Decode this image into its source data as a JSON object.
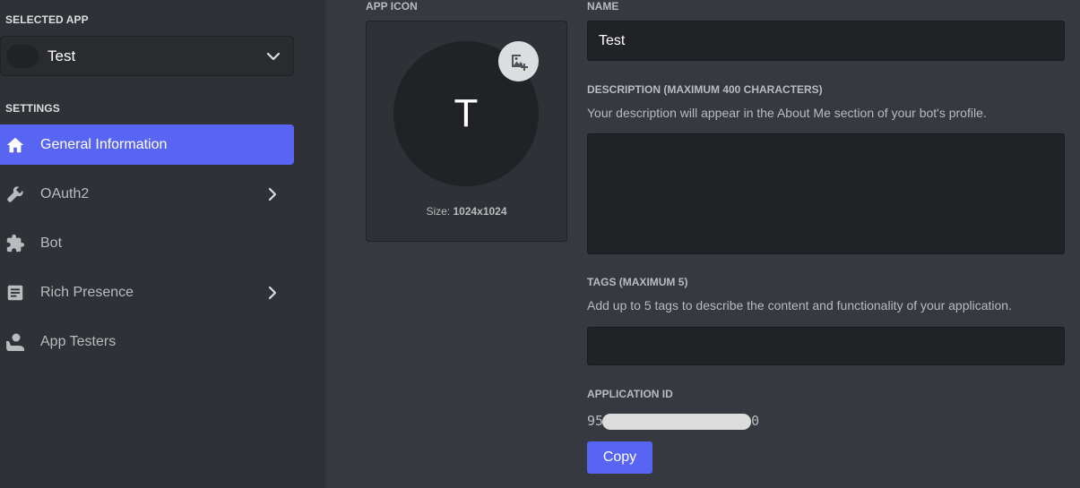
{
  "sidebar": {
    "selected_app_label": "SELECTED APP",
    "selected_app_name": "Test",
    "settings_label": "SETTINGS",
    "items": [
      {
        "label": "General Information",
        "icon": "home-icon",
        "active": true
      },
      {
        "label": "OAuth2",
        "icon": "wrench-icon"
      },
      {
        "label": "Bot",
        "icon": "puzzle-icon"
      },
      {
        "label": "Rich Presence",
        "icon": "document-icon"
      },
      {
        "label": "App Testers",
        "icon": "person-icon"
      }
    ]
  },
  "app_icon": {
    "label": "APP ICON",
    "letter": "T",
    "size_prefix": "Size:",
    "size_value": "1024x1024"
  },
  "name": {
    "label": "NAME",
    "value": "Test"
  },
  "description": {
    "label": "DESCRIPTION (MAXIMUM 400 CHARACTERS)",
    "helper": "Your description will appear in the About Me section of your bot's profile.",
    "value": ""
  },
  "tags": {
    "label": "TAGS (MAXIMUM 5)",
    "helper": "Add up to 5 tags to describe the content and functionality of your application.",
    "value": ""
  },
  "application_id": {
    "label": "APPLICATION ID",
    "prefix": "95",
    "suffix": "0",
    "copy_label": "Copy"
  },
  "colors": {
    "accent": "#5865f2",
    "background": "#36393f",
    "sidebar": "#2f3136"
  }
}
